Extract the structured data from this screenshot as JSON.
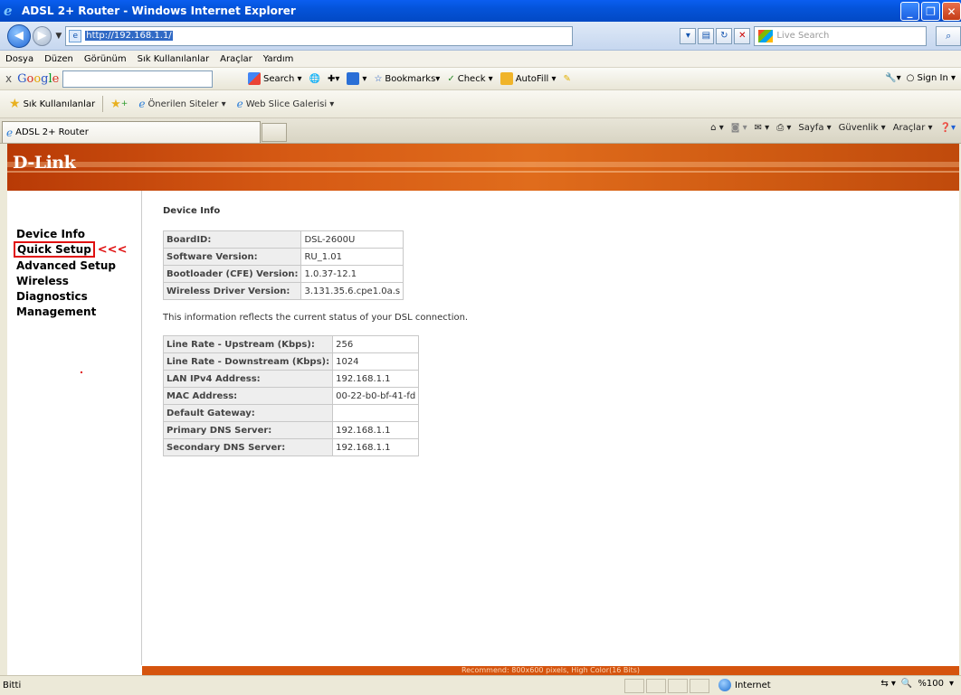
{
  "window": {
    "title": "ADSL 2+ Router - Windows Internet Explorer"
  },
  "address": {
    "url": "http://192.168.1.1/",
    "search_placeholder": "Live Search"
  },
  "menu": [
    "Dosya",
    "Düzen",
    "Görünüm",
    "Sık Kullanılanlar",
    "Araçlar",
    "Yardım"
  ],
  "google_toolbar": {
    "brand": "Google",
    "search": "Search",
    "bookmarks": "Bookmarks",
    "check": "Check",
    "autofill": "AutoFill",
    "signin": "Sign In"
  },
  "favorites_bar": {
    "label": "Sık Kullanılanlar",
    "items": [
      "Önerilen Siteler",
      "Web Slice Galerisi"
    ]
  },
  "tab": {
    "title": "ADSL 2+ Router"
  },
  "command_bar": {
    "page": "Sayfa",
    "safety": "Güvenlik",
    "tools": "Araçlar"
  },
  "brand": {
    "logo": "D-Link"
  },
  "sidebar": {
    "items": [
      "Device Info",
      "Quick Setup",
      "Advanced Setup",
      "Wireless",
      "Diagnostics",
      "Management"
    ],
    "annotation": "<<<"
  },
  "main": {
    "title": "Device Info",
    "device_table": [
      {
        "key": "BoardID:",
        "value": "DSL-2600U"
      },
      {
        "key": "Software Version:",
        "value": "RU_1.01"
      },
      {
        "key": "Bootloader (CFE) Version:",
        "value": "1.0.37-12.1"
      },
      {
        "key": "Wireless Driver Version:",
        "value": "3.131.35.6.cpe1.0a.s"
      }
    ],
    "note": "This information reflects the current status of your DSL connection.",
    "status_table": [
      {
        "key": "Line Rate - Upstream (Kbps):",
        "value": "256"
      },
      {
        "key": "Line Rate - Downstream (Kbps):",
        "value": "1024"
      },
      {
        "key": "LAN IPv4 Address:",
        "value": "192.168.1.1"
      },
      {
        "key": "MAC Address:",
        "value": "00-22-b0-bf-41-fd"
      },
      {
        "key": "Default Gateway:",
        "value": ""
      },
      {
        "key": "Primary DNS Server:",
        "value": "192.168.1.1"
      },
      {
        "key": "Secondary DNS Server:",
        "value": "192.168.1.1"
      }
    ],
    "footer": "Recommend: 800x600 pixels, High Color(16 Bits)"
  },
  "statusbar": {
    "left": "Bitti",
    "zone": "Internet",
    "zoom": "%100"
  }
}
